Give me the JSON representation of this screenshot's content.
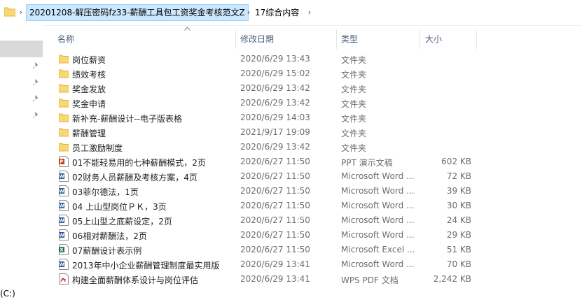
{
  "address_bar": {
    "crumbs": [
      {
        "label": "20201208-解压密码fz33-薪酬工具包工资奖金考核范文Z"
      },
      {
        "label": "17综合内容"
      }
    ],
    "separator_icon": "chevron-right-icon"
  },
  "nav_pane": {
    "drive_label": "(C:)",
    "pin_icon": "pin-icon",
    "pin_count": 4
  },
  "columns": {
    "name": "名称",
    "date": "修改日期",
    "type": "类型",
    "size": "大小",
    "sort_icon": "sort-ascending-icon"
  },
  "colors": {
    "folder": "#f8d775",
    "folder_dark": "#e0b443",
    "word": "#2b579a",
    "ppt": "#c43e1c",
    "excel": "#217346",
    "pdf": "#d32f2f",
    "selected_crumb": "#cce8ff"
  },
  "files": [
    {
      "name": "岗位薪资",
      "date": "2020/6/29 13:43",
      "type": "文件夹",
      "size": "",
      "icon": "folder-icon"
    },
    {
      "name": "绩效考核",
      "date": "2020/6/29 15:02",
      "type": "文件夹",
      "size": "",
      "icon": "folder-icon"
    },
    {
      "name": "奖金发放",
      "date": "2020/6/29 13:42",
      "type": "文件夹",
      "size": "",
      "icon": "folder-icon"
    },
    {
      "name": "奖金申请",
      "date": "2020/6/29 13:42",
      "type": "文件夹",
      "size": "",
      "icon": "folder-icon"
    },
    {
      "name": "新补充-薪酬设计--电子版表格",
      "date": "2020/6/29 14:03",
      "type": "文件夹",
      "size": "",
      "icon": "folder-icon"
    },
    {
      "name": "薪酬管理",
      "date": "2021/9/17 19:09",
      "type": "文件夹",
      "size": "",
      "icon": "folder-icon"
    },
    {
      "name": "员工激励制度",
      "date": "2020/6/29 13:42",
      "type": "文件夹",
      "size": "",
      "icon": "folder-icon"
    },
    {
      "name": "01不能轻易用的七种薪酬模式，2页",
      "date": "2020/6/27 11:50",
      "type": "PPT 演示文稿",
      "size": "602 KB",
      "icon": "ppt-icon"
    },
    {
      "name": "02财务人员薪酬及考核方案，4页",
      "date": "2020/6/27 11:50",
      "type": "Microsoft Word ...",
      "size": "72 KB",
      "icon": "word-icon"
    },
    {
      "name": "03菲尔德法，1页",
      "date": "2020/6/27 11:50",
      "type": "Microsoft Word ...",
      "size": "39 KB",
      "icon": "word-icon"
    },
    {
      "name": "04 上山型岗位ＰＫ，3页",
      "date": "2020/6/27 11:50",
      "type": "Microsoft Word ...",
      "size": "30 KB",
      "icon": "word-icon"
    },
    {
      "name": "05上山型之底薪设定，2页",
      "date": "2020/6/27 11:50",
      "type": "Microsoft Word ...",
      "size": "24 KB",
      "icon": "word-icon"
    },
    {
      "name": "06相对薪酬法，2页",
      "date": "2020/6/27 11:50",
      "type": "Microsoft Word ...",
      "size": "29 KB",
      "icon": "word-icon"
    },
    {
      "name": "07薪酬设计表示例",
      "date": "2020/6/27 11:50",
      "type": "Microsoft Excel ...",
      "size": "51 KB",
      "icon": "excel-icon"
    },
    {
      "name": "2013年中小企业薪酬管理制度最实用版",
      "date": "2020/6/29 13:41",
      "type": "Microsoft Word ...",
      "size": "70 KB",
      "icon": "word-icon"
    },
    {
      "name": "构建全面薪酬体系设计与岗位评估",
      "date": "2020/6/29 13:41",
      "type": "WPS PDF 文档",
      "size": "2,242 KB",
      "icon": "pdf-icon"
    }
  ]
}
